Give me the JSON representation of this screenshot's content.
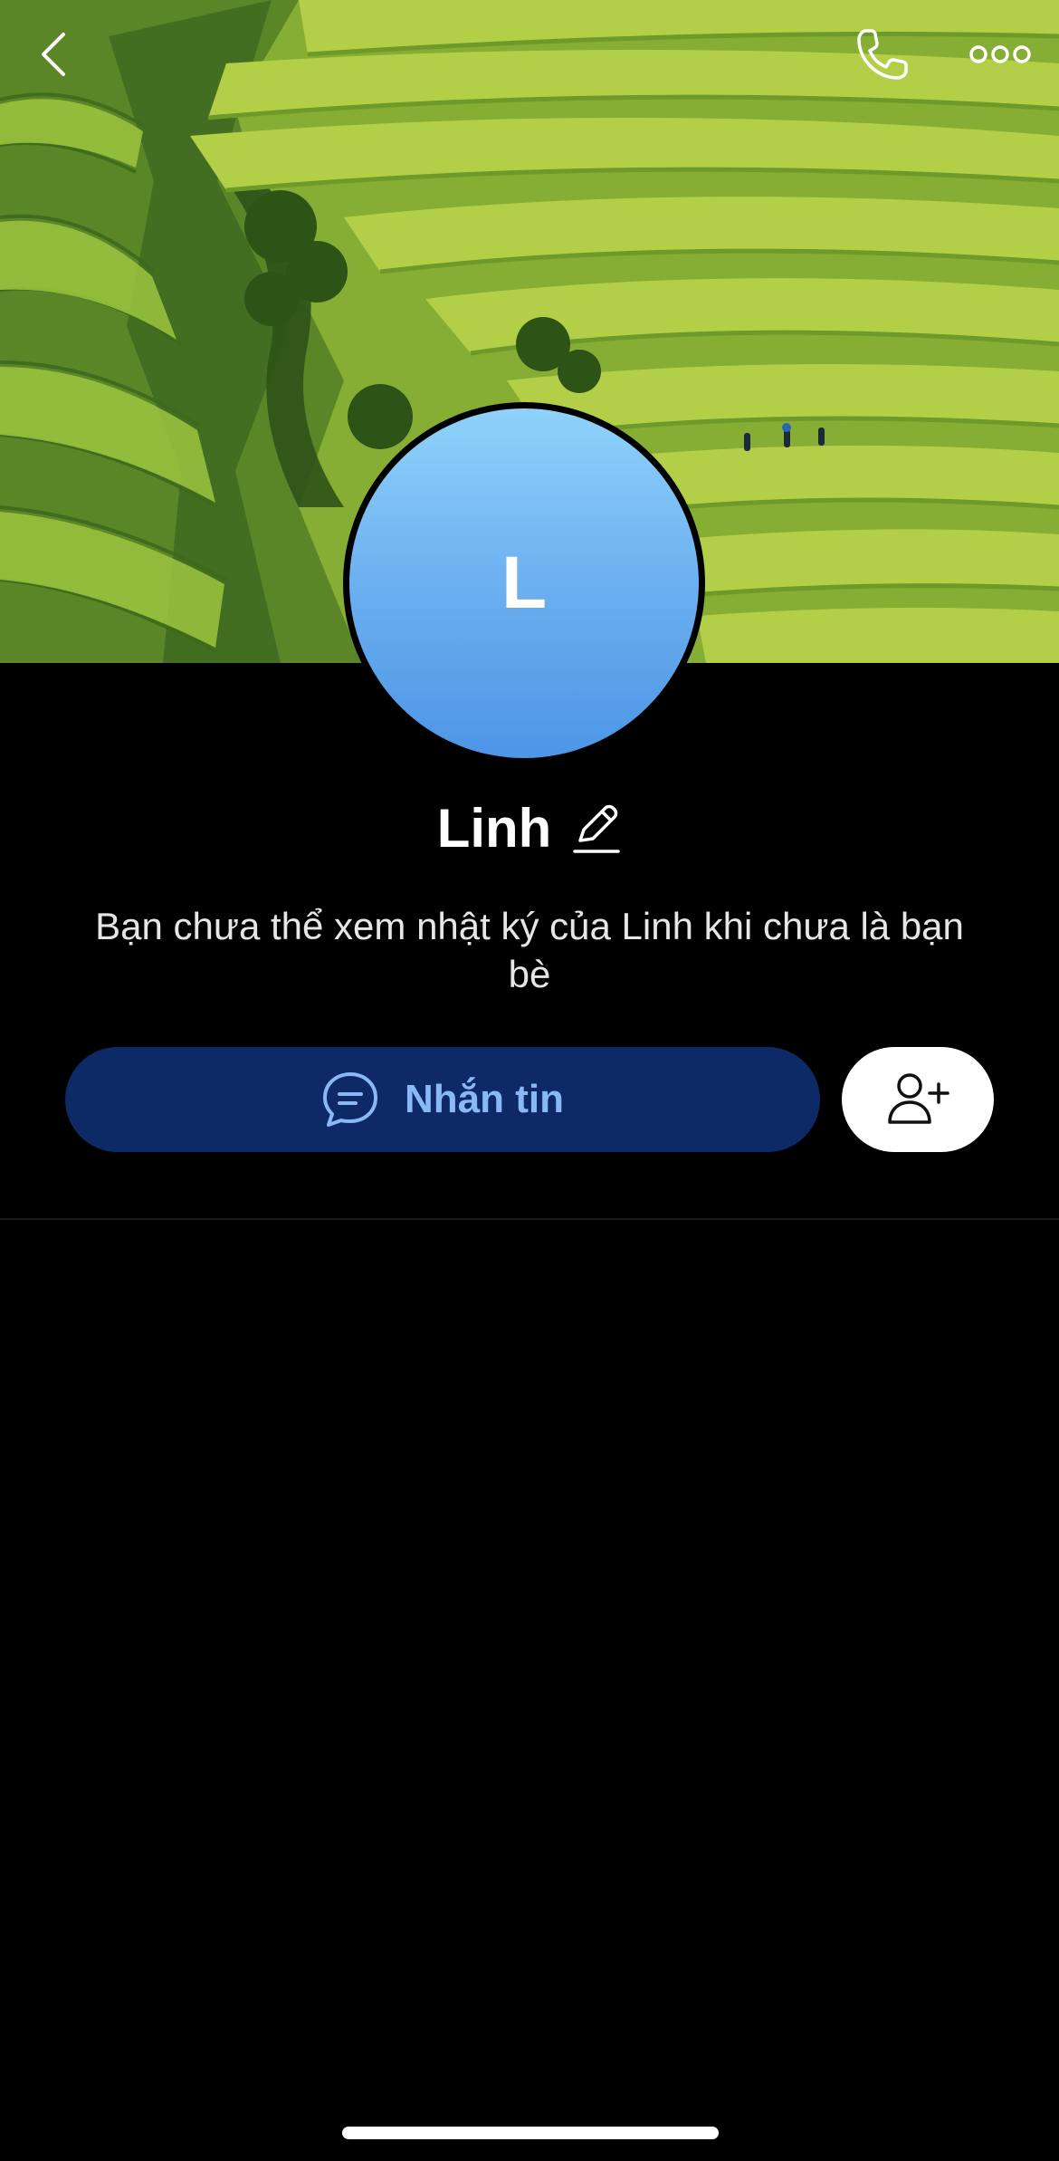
{
  "profile": {
    "name": "Linh",
    "avatar_initial": "L",
    "notice": "Bạn chưa thể xem nhật ký của Linh khi chưa là bạn bè"
  },
  "actions": {
    "message_label": "Nhắn tin"
  },
  "icons": {
    "back": "chevron-left-icon",
    "call": "phone-icon",
    "more": "more-horizontal-icon",
    "edit": "pencil-icon",
    "message": "chat-bubble-icon",
    "add_friend": "add-user-icon"
  },
  "colors": {
    "background": "#000000",
    "message_button_bg": "#0d2a66",
    "message_button_text": "#8ab8f5",
    "avatar_top": "#8fd3fb",
    "avatar_bottom": "#4d95e6"
  }
}
